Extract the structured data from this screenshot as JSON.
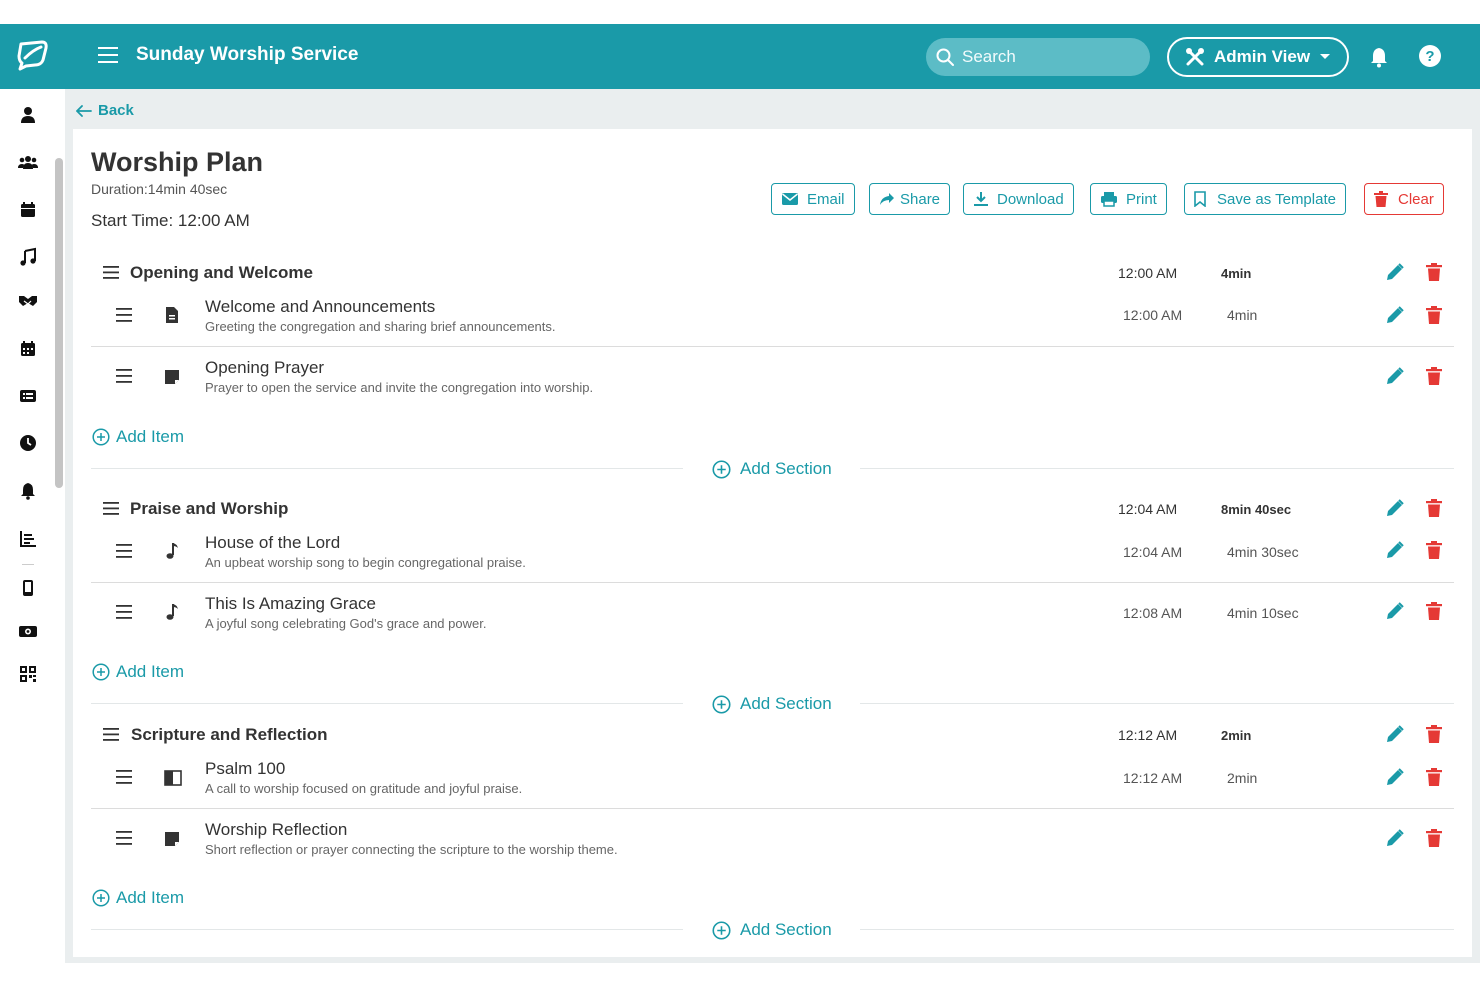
{
  "header": {
    "title": "Sunday Worship Service",
    "search_placeholder": "Search",
    "admin_label": "Admin View"
  },
  "colors": {
    "brand": "#1a9aa8",
    "danger": "#e53935",
    "background": "#eaeeef"
  },
  "nav": {
    "back_label": "Back",
    "sidebar_icons": [
      "person-icon",
      "group-icon",
      "calendar-icon",
      "music-icon",
      "handshake-icon",
      "calendar-days-icon",
      "list-icon",
      "clock-icon",
      "bell-icon",
      "chart-icon",
      "mobile-icon",
      "money-icon",
      "qr-code-icon"
    ]
  },
  "plan": {
    "title": "Worship Plan",
    "duration": "Duration:14min 40sec",
    "start_time": "Start Time: 12:00 AM"
  },
  "actions": {
    "email": "Email",
    "share": "Share",
    "download": "Download",
    "print": "Print",
    "save_template": "Save as Template",
    "clear": "Clear"
  },
  "labels": {
    "add_item": "Add Item",
    "add_section": "Add Section"
  },
  "sections": [
    {
      "title": "Opening and Welcome",
      "start": "12:00 AM",
      "duration": "4min",
      "items": [
        {
          "icon": "document-icon",
          "title": "Welcome and Announcements",
          "desc": "Greeting the congregation and sharing brief announcements.",
          "start": "12:00 AM",
          "duration": "4min"
        },
        {
          "icon": "note-icon",
          "title": "Opening Prayer",
          "desc": "Prayer to open the service and invite the congregation into worship.",
          "start": "",
          "duration": ""
        }
      ]
    },
    {
      "title": "Praise and Worship",
      "start": "12:04 AM",
      "duration": "8min 40sec",
      "items": [
        {
          "icon": "music-note-icon",
          "title": "House of the Lord",
          "desc": "An upbeat worship song to begin congregational praise.",
          "start": "12:04 AM",
          "duration": "4min 30sec"
        },
        {
          "icon": "music-note-icon",
          "title": "This Is Amazing Grace",
          "desc": "A joyful song celebrating God's grace and power.",
          "start": "12:08 AM",
          "duration": "4min 10sec"
        }
      ]
    },
    {
      "title": "Scripture and Reflection",
      "start": "12:12 AM",
      "duration": "2min",
      "items": [
        {
          "icon": "book-icon",
          "title": "Psalm 100",
          "desc": "A call to worship focused on gratitude and joyful praise.",
          "start": "12:12 AM",
          "duration": "2min"
        },
        {
          "icon": "note-icon",
          "title": "Worship Reflection",
          "desc": "Short reflection or prayer connecting the scripture to the worship theme.",
          "start": "",
          "duration": ""
        }
      ]
    }
  ]
}
